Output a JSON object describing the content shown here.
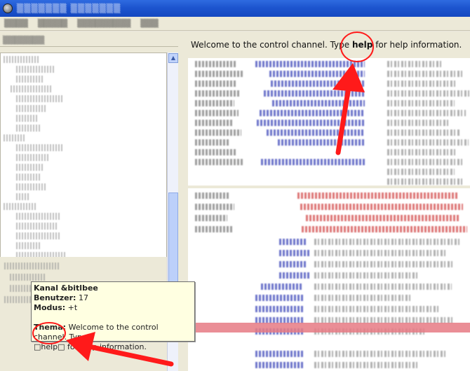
{
  "topic": {
    "prefix": "Welcome to the control channel. Type ",
    "keyword": "help",
    "suffix": " for help information."
  },
  "tooltip": {
    "channel_label": "Kanal &bitlbee",
    "users_label": "Benutzer:",
    "users_value": " 17",
    "modes_label": "Modus:",
    "modes_value": " +t",
    "topic_label": "Thema:",
    "topic_line1": " Welcome to the control channel. Type",
    "topic_line2": "□help□ for help information."
  },
  "colors": {
    "annotation_red": "#ff1a1a",
    "titlebar_blue": "#1d55cf",
    "tooltip_bg": "#ffffe1",
    "highlight": "#e67a84"
  },
  "icons": {
    "app": "app-icon",
    "scroll_up": "arrow-up-icon",
    "scroll_down": "arrow-down-icon"
  }
}
